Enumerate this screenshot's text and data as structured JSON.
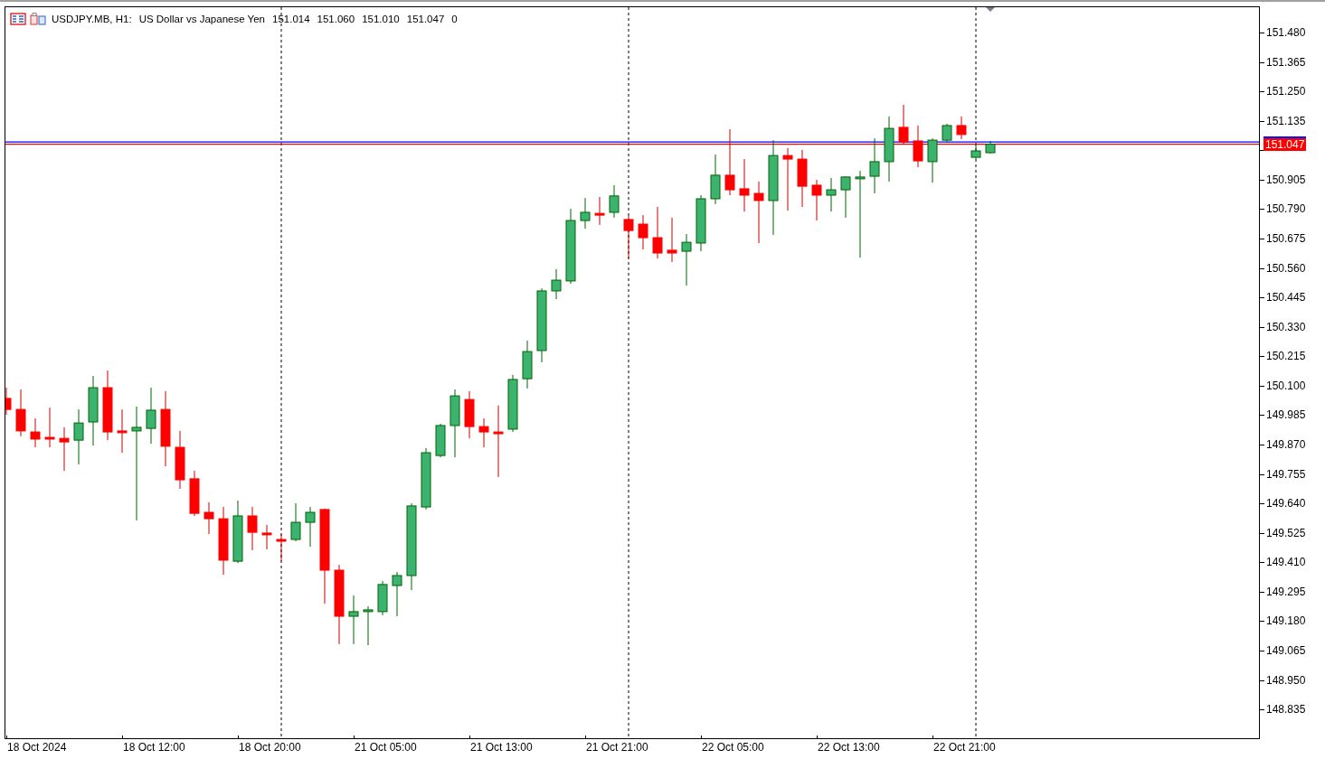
{
  "header": {
    "symbol": "USDJPY.MB, H1:",
    "description": "US Dollar vs Japanese Yen",
    "values": [
      "151.014",
      "151.060",
      "151.010",
      "151.047"
    ],
    "volume": "0"
  },
  "price_axis": {
    "labels": [
      "151.480",
      "151.365",
      "151.250",
      "151.135",
      "150.905",
      "150.790",
      "150.675",
      "150.560",
      "150.445",
      "150.330",
      "150.215",
      "150.100",
      "149.985",
      "149.870",
      "149.755",
      "149.640",
      "149.525",
      "149.410",
      "149.295",
      "149.180",
      "149.065",
      "148.950",
      "148.835"
    ],
    "price_tag": "151.047"
  },
  "time_axis": {
    "labels": [
      "18 Oct 2024",
      "18 Oct 12:00",
      "18 Oct 20:00",
      "21 Oct 05:00",
      "21 Oct 13:00",
      "21 Oct 21:00",
      "22 Oct 05:00",
      "22 Oct 13:00",
      "22 Oct 21:00"
    ]
  }
}
